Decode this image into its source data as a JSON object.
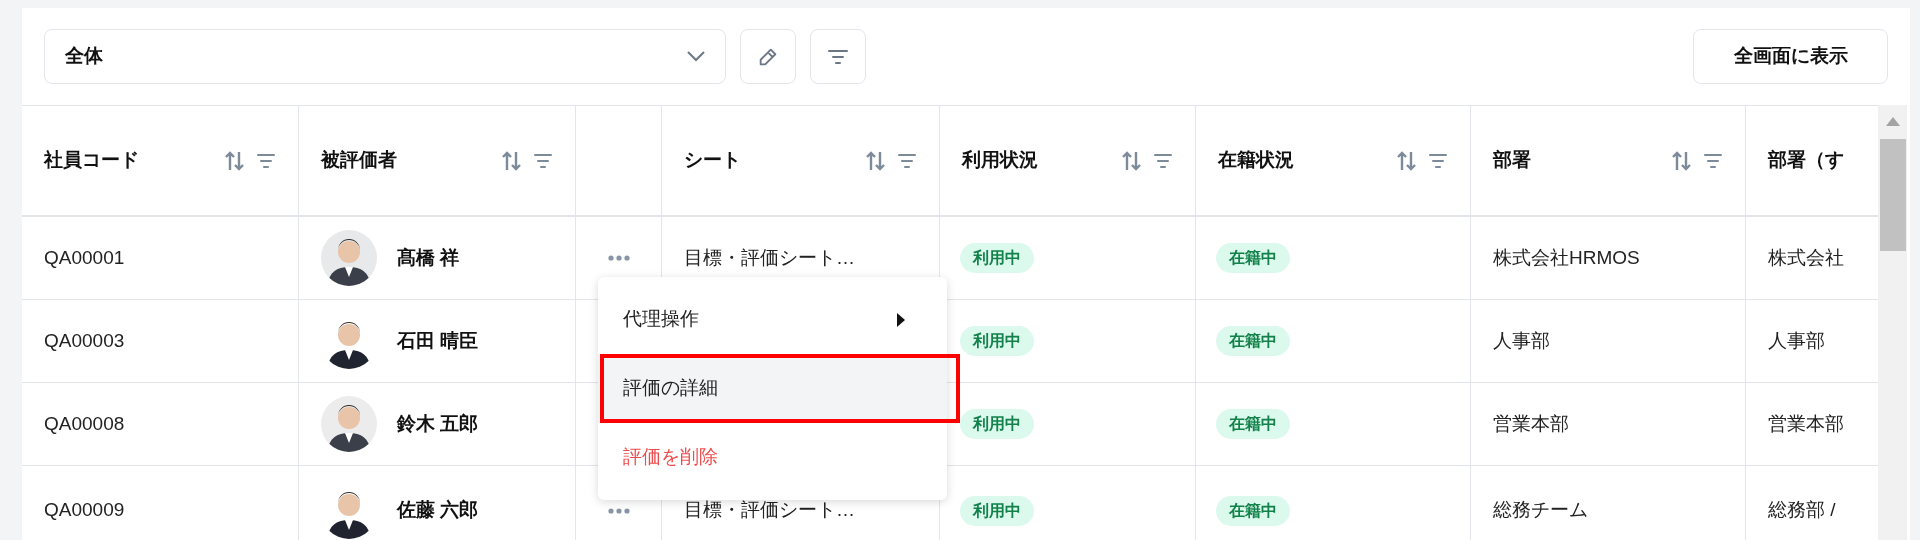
{
  "toolbar": {
    "view_select": {
      "value": "全体"
    },
    "fullscreen_button": "全画面に表示"
  },
  "table": {
    "columns": [
      {
        "label": "社員コード",
        "sortable": true,
        "filterable": true
      },
      {
        "label": "被評価者",
        "sortable": true,
        "filterable": true
      },
      {
        "sortable": false,
        "filterable": false
      },
      {
        "label": "シート",
        "sortable": true,
        "filterable": true
      },
      {
        "label": "利用状況",
        "sortable": true,
        "filterable": true
      },
      {
        "label": "在籍状況",
        "sortable": true,
        "filterable": true
      },
      {
        "label": "部署",
        "sortable": true,
        "filterable": true
      },
      {
        "label": "部署（す",
        "sortable": false,
        "filterable": false
      }
    ],
    "rows": [
      {
        "code": "QA00001",
        "name": "髙橋 祥",
        "menu_button": true,
        "sheet": "目標・評価シート…",
        "usage": "利用中",
        "enrollment": "在籍中",
        "dept": "株式会社HRMOS",
        "dept_all": "株式会社"
      },
      {
        "code": "QA00003",
        "name": "石田 晴臣",
        "usage": "利用中",
        "enrollment": "在籍中",
        "dept": "人事部",
        "dept_all": "人事部"
      },
      {
        "code": "QA00008",
        "name": "鈴木 五郎",
        "usage": "利用中",
        "enrollment": "在籍中",
        "dept": "営業本部",
        "dept_all": "営業本部"
      },
      {
        "code": "QA00009",
        "name": "佐藤 六郎",
        "menu_button": true,
        "sheet": "目標・評価シート…",
        "usage": "利用中",
        "enrollment": "在籍中",
        "dept": "総務チーム",
        "dept_all": "総務部 /"
      }
    ]
  },
  "context_menu": {
    "items": [
      {
        "label": "代理操作",
        "kind": "submenu",
        "selected": false,
        "annotated": false
      },
      {
        "label": "評価の詳細",
        "kind": "action",
        "selected": true,
        "annotated": true
      },
      {
        "label": "評価を削除",
        "kind": "danger",
        "selected": false,
        "annotated": false
      }
    ]
  }
}
